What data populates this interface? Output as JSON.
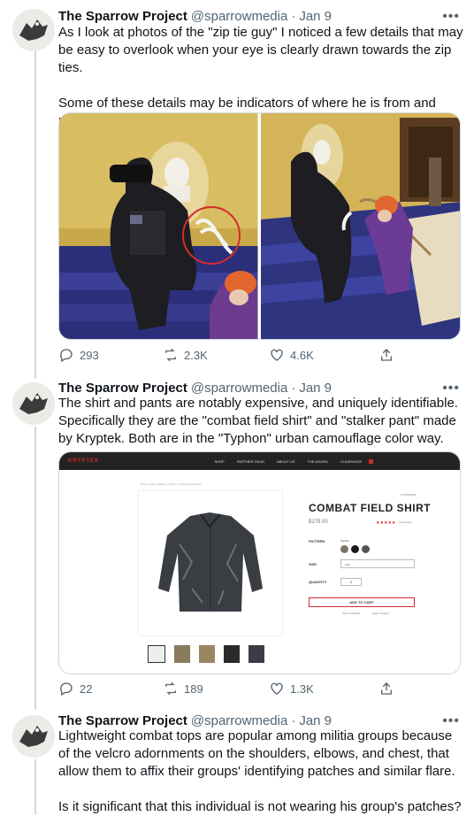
{
  "tweets": [
    {
      "name": "The Sparrow Project",
      "handle": "@sparrowmedia",
      "dot": "·",
      "date": "Jan 9",
      "text": "As I look at photos of the \"zip tie guy\" I noticed a few details that may be easy to overlook when your eye is clearly drawn towards the zip ties.\n\nSome of these details may be indicators of where he is from and possible group affiliation.",
      "replies": "293",
      "retweets": "2.3K",
      "likes": "4.6K"
    },
    {
      "name": "The Sparrow Project",
      "handle": "@sparrowmedia",
      "dot": "·",
      "date": "Jan 9",
      "text": "The shirt and pants are notably expensive, and uniquely identifiable. Specifically they are the \"combat field shirt\" and \"stalker pant\" made by Kryptek. Both are in the \"Typhon\" urban camouflage color way.",
      "replies": "22",
      "retweets": "189",
      "likes": "1.3K"
    },
    {
      "name": "The Sparrow Project",
      "handle": "@sparrowmedia",
      "dot": "·",
      "date": "Jan 9",
      "text": "Lightweight combat tops are popular among militia groups because of the velcro adornments on the shoulders, elbows, and chest, that allow them to affix their groups' identifying patches and similar flare.\n\nIs it significant that this individual is not wearing his group's patches?"
    }
  ],
  "more_icon": "•••",
  "store": {
    "brand": "KRYPTEK",
    "nav": [
      "SHOP",
      "PARTNER GEAR",
      "ABOUT US",
      "THE AGORA",
      "CLEARANCE"
    ],
    "breadcrumb": "Home / Camo Pattern / Typhon / Combat Field Shirt",
    "sku": "STCOMFSR",
    "product_title": "COMBAT FIELD SHIRT",
    "price": "$179.00",
    "reviews": "(3 reviews)",
    "pattern_label": "PATTERN",
    "pattern_value": "Typhon",
    "size_label": "SIZE",
    "size_value": "Size",
    "quantity_label": "QUANTITY",
    "quantity_value": "1",
    "add_to_cart": "ADD TO CART",
    "wishlist": "Add to Wishlist",
    "share": "Share Product"
  },
  "colors": {
    "accent_red": "#d32c2c",
    "icon_gray": "#536471",
    "thread_line": "#cfd9de"
  }
}
